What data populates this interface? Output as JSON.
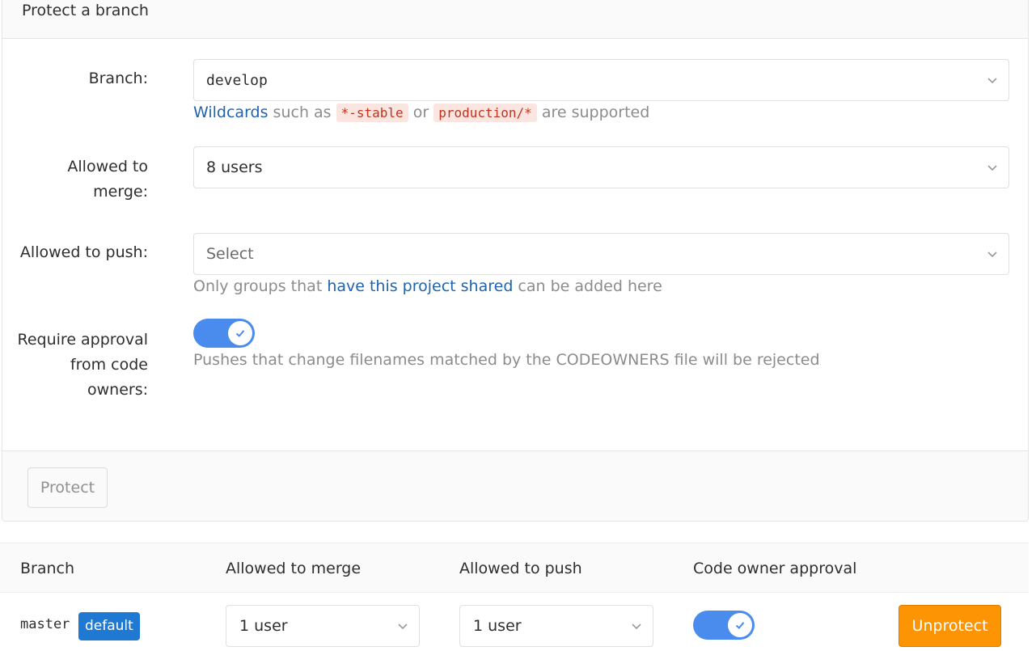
{
  "form": {
    "title": "Protect a branch",
    "branch": {
      "label": "Branch:",
      "value": "develop",
      "help_link": "Wildcards",
      "help_text1": " such as ",
      "help_code1": "*-stable",
      "help_text2": " or ",
      "help_code2": "production/*",
      "help_text3": " are supported"
    },
    "merge": {
      "label_line1": "Allowed to",
      "label_line2": "merge:",
      "value": "8 users"
    },
    "push": {
      "label": "Allowed to push:",
      "placeholder": "Select",
      "help_text1": "Only groups that ",
      "help_link": "have this project shared",
      "help_text2": " can be added here"
    },
    "codeowners": {
      "label_line1": "Require approval",
      "label_line2": "from code",
      "label_line3": "owners:",
      "enabled": true,
      "help": "Pushes that change filenames matched by the CODEOWNERS file will be rejected"
    },
    "protect_label": "Protect"
  },
  "table": {
    "headers": [
      "Branch",
      "Allowed to merge",
      "Allowed to push",
      "Code owner approval"
    ],
    "rows": [
      {
        "branch": "master",
        "badge": "default",
        "merge": "1 user",
        "push": "1 user",
        "code_owner_approval": true,
        "action": "Unprotect"
      }
    ]
  },
  "colors": {
    "accent": "#1f63b0",
    "toggle_on": "#4a8bee",
    "badge": "#1f78d1",
    "warning_button": "#fc9403",
    "code_text": "#c0341d",
    "code_bg": "#fbe5e1"
  },
  "icons": {
    "select_chevron": "chevron-down-icon",
    "toggle_check": "check-icon"
  }
}
